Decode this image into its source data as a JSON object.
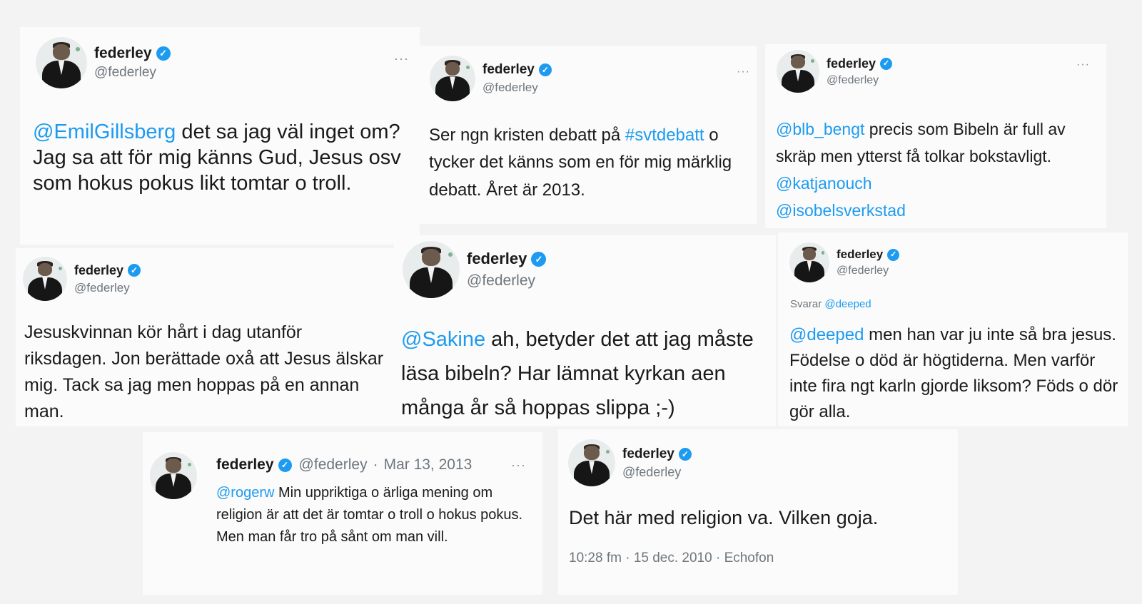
{
  "colors": {
    "accent": "#1d9bf0",
    "text": "#1a1a1a",
    "muted": "#6e767d",
    "background": "#fbfbfb"
  },
  "icons": {
    "verified": "verified-badge-icon",
    "more": "more-options-icon",
    "avatar": "profile-avatar"
  },
  "tweets": [
    {
      "name": "federley",
      "badge": "✓",
      "handle": "@federley",
      "more": "···",
      "body": {
        "mention": "@EmilGillsberg",
        "text": " det sa jag väl inget om? Jag sa att för mig känns Gud, Jesus osv som hokus pokus likt tomtar o troll."
      }
    },
    {
      "name": "federley",
      "badge": "✓",
      "handle": "@federley",
      "more": "···",
      "body": {
        "pre": "Ser ngn kristen debatt på ",
        "hashtag": "#svtdebatt",
        "post": " o tycker det känns som en för mig märklig debatt. Året är 2013."
      }
    },
    {
      "name": "federley",
      "badge": "✓",
      "handle": "@federley",
      "more": "···",
      "body": {
        "mention": "@blb_bengt",
        "text": " precis som Bibeln är full av skräp men ytterst få tolkar bokstavligt. ",
        "mention2": "@katjanouch",
        "mention3": "@isobelsverkstad"
      }
    },
    {
      "name": "federley",
      "badge": "✓",
      "handle": "@federley",
      "body": {
        "text": "Jesuskvinnan kör hårt i dag utanför riksdagen. Jon berättade oxå att Jesus älskar mig. Tack sa jag men hoppas på en annan man."
      }
    },
    {
      "name": "federley",
      "badge": "✓",
      "handle": "@federley",
      "body": {
        "mention": "@Sakine",
        "text": " ah, betyder det att jag måste läsa bibeln? Har lämnat kyrkan aen många år så hoppas slippa ;-)"
      }
    },
    {
      "name": "federley",
      "badge": "✓",
      "handle": "@federley",
      "reply": {
        "prefix": "Svarar ",
        "to": "@deeped"
      },
      "body": {
        "mention": "@deeped",
        "text": " men han var ju inte så bra jesus. Födelse o död är högtiderna. Men varför inte fira ngt karln gjorde liksom? Föds o dör gör alla."
      }
    },
    {
      "name": "federley",
      "badge": "✓",
      "handle": "@federley",
      "sep": "·",
      "date": "Mar 13, 2013",
      "more": "···",
      "body": {
        "mention": "@rogerw",
        "text": " Min uppriktiga o ärliga mening om religion är att det är tomtar o troll o hokus pokus. Men man får tro på sånt om man vill."
      }
    },
    {
      "name": "federley",
      "badge": "✓",
      "handle": "@federley",
      "body": {
        "text": "Det här med religion va. Vilken goja."
      },
      "meta": "10:28 fm · 15 dec. 2010 · Echofon"
    }
  ]
}
